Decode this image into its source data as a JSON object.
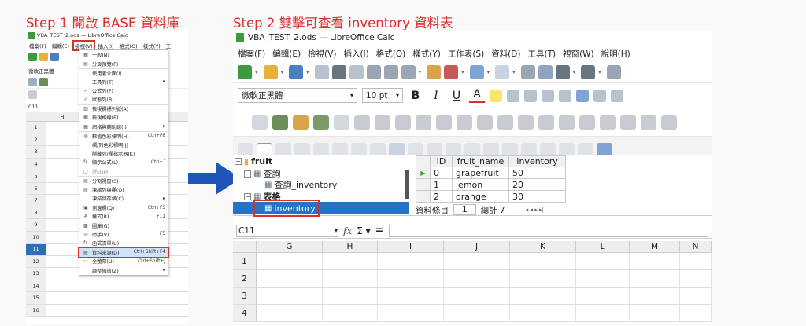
{
  "step1": {
    "title": "Step 1 開啟 BASE 資料庫"
  },
  "step2": {
    "title": "Step 2 雙擊可查看 inventory 資料表"
  },
  "left": {
    "window_title": "VBA_TEST_2.ods — LibreOffice Calc",
    "menu": [
      "檔案(F)",
      "編輯(E)",
      "檢視(V)",
      "插入(I)",
      "格式(O)",
      "樣式(Y)",
      "工"
    ],
    "font": "微軟正黑體",
    "cell_ref": "C11",
    "col_header": "H",
    "rows": [
      "1",
      "2",
      "3",
      "4",
      "5",
      "6",
      "7",
      "8",
      "9",
      "10",
      "11",
      "12",
      "13",
      "14",
      "15",
      "16"
    ],
    "selected_row": "11",
    "view_menu": [
      {
        "icon": "▦",
        "label": "一般(N)",
        "acc": ""
      },
      {
        "icon": "▤",
        "label": "分頁預覽(P)",
        "acc": ""
      },
      {
        "icon": "",
        "label": "使用者介面(I)...",
        "acc": ""
      },
      {
        "icon": "",
        "label": "工具列(T)",
        "acc": "▸"
      },
      {
        "icon": "✓",
        "label": "公式列(F)",
        "acc": ""
      },
      {
        "icon": "✓",
        "label": "狀態列(B)",
        "acc": ""
      },
      {
        "icon": "▥",
        "label": "檢視欄標列號(A)",
        "acc": ""
      },
      {
        "icon": "▦",
        "label": "檢視格線(E)",
        "acc": ""
      },
      {
        "icon": "▦",
        "label": "網格與輔助線(I)",
        "acc": "▸"
      },
      {
        "icon": "◍",
        "label": "數值色彩標明(H)",
        "acc": "Ctrl+F8"
      },
      {
        "icon": "",
        "label": "欄/列色彩標明(J)",
        "acc": ""
      },
      {
        "icon": "",
        "label": "隱藏列/欄指示器(K)",
        "acc": ""
      },
      {
        "icon": "fx",
        "label": "顯示公式(L)",
        "acc": "Ctrl+`"
      },
      {
        "icon": "▢",
        "label": "評註(M)",
        "acc": ""
      },
      {
        "icon": "▤",
        "label": "分割視窗(S)",
        "acc": ""
      },
      {
        "icon": "▤",
        "label": "凍結列與欄(O)",
        "acc": ""
      },
      {
        "icon": "",
        "label": "凍結儲存格(C)",
        "acc": "▸"
      },
      {
        "icon": "▣",
        "label": "側邊欄(Q)",
        "acc": "Ctrl+F5"
      },
      {
        "icon": "A",
        "label": "樣式(R)",
        "acc": "F11"
      },
      {
        "icon": "▩",
        "label": "圖庫(G)",
        "acc": ""
      },
      {
        "icon": "◎",
        "label": "助手(V)",
        "acc": "F5"
      },
      {
        "icon": "fx",
        "label": "函式清單(U)",
        "acc": ""
      },
      {
        "icon": "▤",
        "label": "資料來源(D)",
        "acc": "Ctrl+Shift+F4"
      },
      {
        "icon": "▭",
        "label": "全螢幕(U)",
        "acc": "Ctrl+Shift+J"
      },
      {
        "icon": "",
        "label": "調整縮放(Z)",
        "acc": "▸"
      }
    ]
  },
  "right": {
    "window_title": "VBA_TEST_2.ods — LibreOffice Calc",
    "menu": [
      "檔案(F)",
      "編輯(E)",
      "檢視(V)",
      "插入(I)",
      "格式(O)",
      "樣式(Y)",
      "工作表(S)",
      "資料(D)",
      "工具(T)",
      "視窗(W)",
      "說明(H)"
    ],
    "font": "微軟正黑體",
    "font_size": "10 pt",
    "tree": {
      "root": "fruit",
      "queries": "查詢",
      "query_item": "查詢_inventory",
      "tables": "表格",
      "table_item": "inventory"
    },
    "grid": {
      "headers": [
        "ID",
        "fruit_name",
        "Inventory"
      ],
      "rows": [
        [
          "0",
          "grapefruit",
          "50"
        ],
        [
          "1",
          "lemon",
          "20"
        ],
        [
          "2",
          "orange",
          "30"
        ]
      ]
    },
    "nav": {
      "label": "資料條目",
      "record": "1",
      "total": "總計 7"
    },
    "cell_ref": "C11",
    "columns": [
      "G",
      "H",
      "I",
      "J",
      "K",
      "L",
      "M",
      "N"
    ],
    "rows": [
      "1",
      "2",
      "3",
      "4"
    ]
  },
  "colors": {
    "accent_red": "#d9302c",
    "arrow_blue": "#1f55b8",
    "select_blue": "#2573c7"
  }
}
